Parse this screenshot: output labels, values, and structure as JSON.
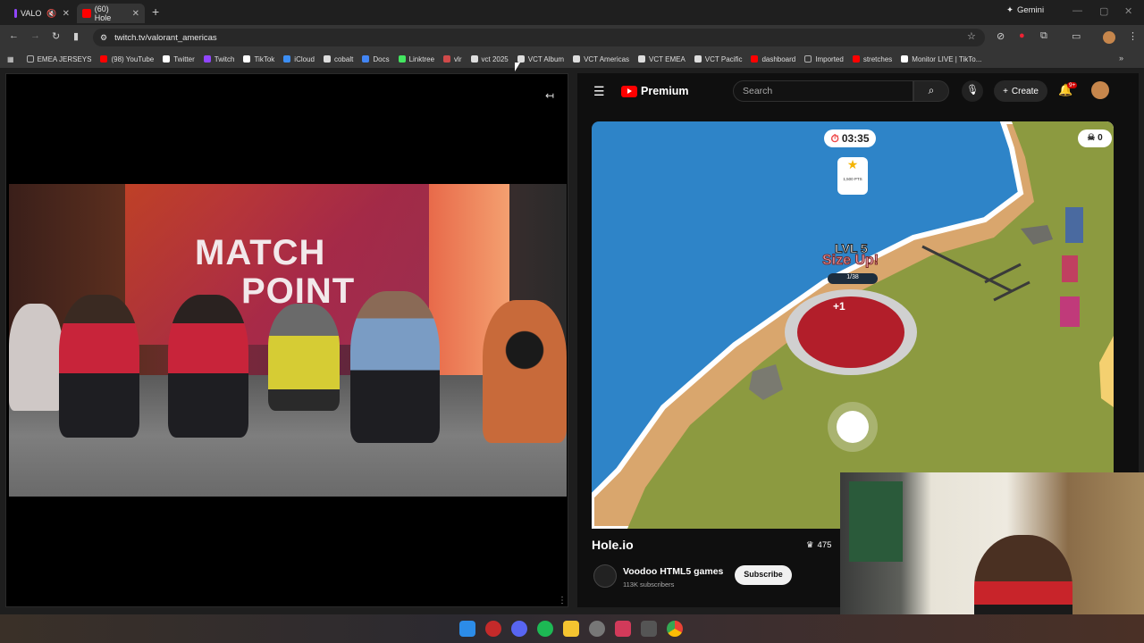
{
  "browser": {
    "tabs": [
      {
        "label": "VALO",
        "active": false
      },
      {
        "label": "(60) Hole",
        "active": true
      }
    ],
    "gemini_label": "Gemini",
    "url": "twitch.tv/valorant_americas"
  },
  "bookmarks": [
    {
      "label": "EMEA JERSEYS",
      "icon": "folder-icon",
      "color": "#b0b0b0"
    },
    {
      "label": "(98) YouTube",
      "icon": "youtube-icon",
      "color": "#ff0000"
    },
    {
      "label": "Twitter",
      "icon": "x-icon",
      "color": "#ffffff"
    },
    {
      "label": "Twitch",
      "icon": "twitch-icon",
      "color": "#9146ff"
    },
    {
      "label": "TikTok",
      "icon": "tiktok-icon",
      "color": "#ffffff"
    },
    {
      "label": "iCloud",
      "icon": "cloud-icon",
      "color": "#3c8ef3"
    },
    {
      "label": "cobalt",
      "icon": "cobalt-icon",
      "color": "#ffffff"
    },
    {
      "label": "Docs",
      "icon": "docs-icon",
      "color": "#4285f4"
    },
    {
      "label": "Linktree",
      "icon": "linktree-icon",
      "color": "#43e660"
    },
    {
      "label": "vlr",
      "icon": "vlr-icon",
      "color": "#d04a4a"
    },
    {
      "label": "vct 2025",
      "icon": "vct-icon",
      "color": "#dddddd"
    },
    {
      "label": "VCT Album",
      "icon": "vct-icon",
      "color": "#dddddd"
    },
    {
      "label": "VCT Americas",
      "icon": "vct-icon",
      "color": "#dddddd"
    },
    {
      "label": "VCT EMEA",
      "icon": "vct-icon",
      "color": "#dddddd"
    },
    {
      "label": "VCT Pacific",
      "icon": "vct-icon",
      "color": "#dddddd"
    },
    {
      "label": "dashboard",
      "icon": "youtube-icon",
      "color": "#ff0000"
    },
    {
      "label": "Imported",
      "icon": "folder-icon",
      "color": "#b0b0b0"
    },
    {
      "label": "stretches",
      "icon": "youtube-icon",
      "color": "#ff0000"
    },
    {
      "label": "Monitor LIVE | TikTo...",
      "icon": "tiktok-icon",
      "color": "#ffffff"
    }
  ],
  "twitch": {
    "stream_text_line1": "MATCH",
    "stream_text_line2": "POINT"
  },
  "youtube": {
    "logo_label": "Premium",
    "search_placeholder": "Search",
    "create_label": "Create",
    "notifications_badge": "9+",
    "game": {
      "timer": "03:35",
      "score": "0",
      "star_points": "1,500 PTS",
      "level": "LVL 5",
      "size_up": "Size Up!",
      "progress": "1/38",
      "plus_one": "+1"
    },
    "video_title": "Hole.io",
    "channel_name": "Voodoo HTML5 games",
    "subscribers": "113K subscribers",
    "subscribe_label": "Subscribe",
    "likes": "475"
  },
  "colors": {
    "youtube_red": "#ff0000",
    "game_water": "#2e84c8",
    "game_sand": "#d9a66d",
    "game_grass": "#8c9a40"
  }
}
